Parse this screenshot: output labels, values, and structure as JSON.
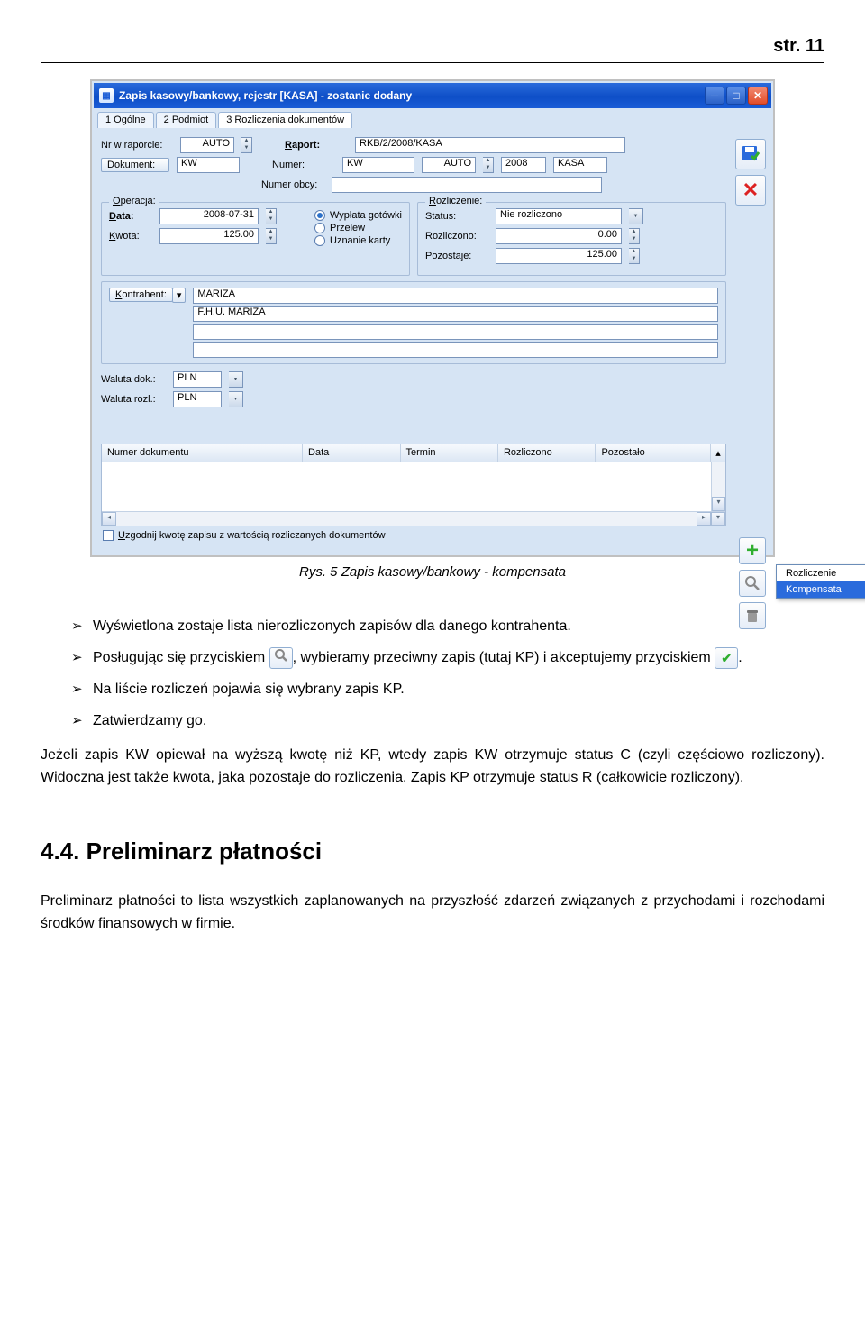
{
  "page_header": "str. 11",
  "window": {
    "title": "Zapis kasowy/bankowy, rejestr [KASA]  - zostanie dodany",
    "tabs": [
      {
        "label": "1 Ogólne"
      },
      {
        "label": "2 Podmiot"
      },
      {
        "label": "3 Rozliczenia dokumentów"
      }
    ],
    "nr_w_raporcie_label": "Nr w raporcie:",
    "nr_w_raporcie_value": "AUTO",
    "dokument_btn": "Dokument:",
    "dokument_value": "KW",
    "raport_label": "Raport:",
    "raport_value": "RKB/2/2008/KASA",
    "numer_label": "Numer:",
    "numer_seg1": "KW",
    "numer_seg2": "AUTO",
    "numer_seg3": "2008",
    "numer_seg4": "KASA",
    "numer_obcy_label": "Numer obcy:",
    "numer_obcy_value": "",
    "operacja_legend": "Operacja:",
    "data_label": "Data:",
    "data_value": "2008-07-31",
    "kwota_label": "Kwota:",
    "kwota_value": "125.00",
    "radio_options": [
      "Wypłata gotówki",
      "Przelew",
      "Uznanie karty"
    ],
    "radio_selected": 0,
    "rozliczenie_legend": "Rozliczenie:",
    "status_label": "Status:",
    "status_value": "Nie rozliczono",
    "rozliczono_label": "Rozliczono:",
    "rozliczono_value": "0.00",
    "pozostaje_label": "Pozostaje:",
    "pozostaje_value": "125.00",
    "kontrahent_btn": "Kontrahent:",
    "kontrahent_line1": "MARIZA",
    "kontrahent_line2": "F.H.U. MARIZA",
    "kontrahent_line3": "",
    "kontrahent_line4": "",
    "waluta_dok_label": "Waluta dok.:",
    "waluta_dok_value": "PLN",
    "waluta_rozl_label": "Waluta rozl.:",
    "waluta_rozl_value": "PLN",
    "table_headers": [
      "Numer dokumentu",
      "Data",
      "Termin",
      "Rozliczono",
      "Pozostało"
    ],
    "uzgodnij_label": "Uzgodnij kwotę zapisu z wartością rozliczanych dokumentów",
    "context_menu": [
      "Rozliczenie",
      "Kompensata"
    ],
    "context_menu_selected": 1
  },
  "caption": "Rys. 5 Zapis kasowy/bankowy - kompensata",
  "bullets": {
    "b1": "Wyświetlona zostaje lista nierozliczonych zapisów dla danego kontrahenta.",
    "b2_pre": "Posługując się przyciskiem ",
    "b2_mid": ", wybieramy przeciwny zapis (tutaj KP) i akceptujemy przyciskiem ",
    "b2_post": ".",
    "b3": "Na liście rozliczeń pojawia się wybrany zapis KP.",
    "b4": "Zatwierdzamy go."
  },
  "para1": "Jeżeli zapis KW opiewał na wyższą kwotę niż KP, wtedy zapis KW otrzymuje status C (czyli częściowo rozliczony). Widoczna jest także kwota, jaka pozostaje do rozliczenia. Zapis KP otrzymuje status R (całkowicie rozliczony).",
  "section_heading": "4.4.    Preliminarz płatności",
  "para2": "Preliminarz płatności to lista wszystkich zaplanowanych na przyszłość zdarzeń związanych z przychodami i rozchodami środków finansowych w firmie."
}
